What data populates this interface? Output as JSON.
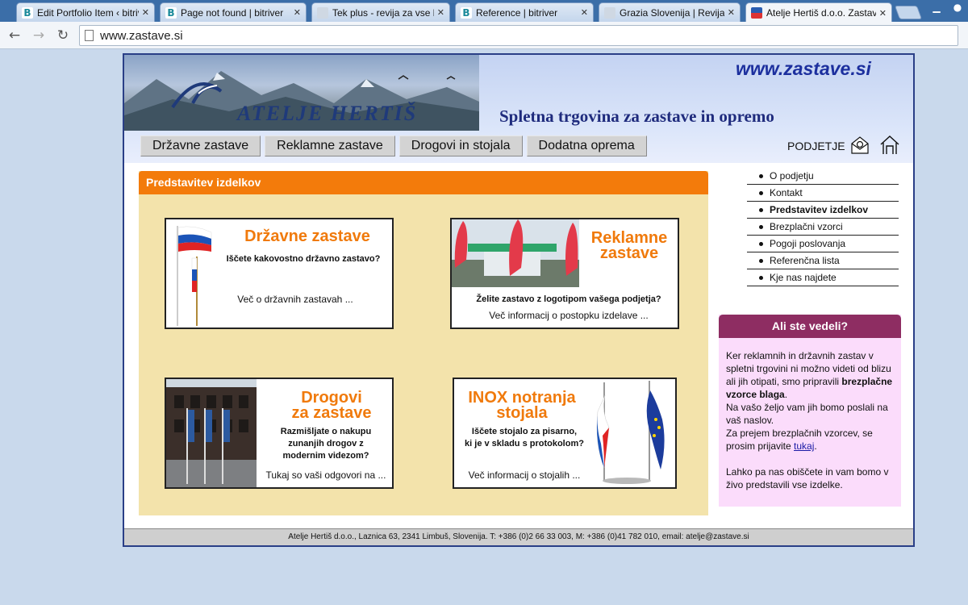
{
  "browser": {
    "tabs": [
      {
        "title": "Edit Portfolio Item ‹ bitriver",
        "favicon": "B"
      },
      {
        "title": "Page not found | bitriver",
        "favicon": "B"
      },
      {
        "title": "Tek plus - revija za vse ljubitelje",
        "favicon": ""
      },
      {
        "title": "Reference | bitriver",
        "favicon": "B"
      },
      {
        "title": "Grazia Slovenija | Revija Grazia",
        "favicon": ""
      },
      {
        "title": "Atelje Hertiš d.o.o. Zastave",
        "favicon": ""
      }
    ],
    "close_glyph": "✕",
    "url": "www.zastave.si",
    "back_glyph": "←",
    "forward_glyph": "→",
    "reload_glyph": "↻"
  },
  "header": {
    "logo_text": "ATELJE HERTIŠ",
    "site_url": "www.zastave.si",
    "tagline": "Spletna trgovina za zastave in opremo",
    "podjetje": "PODJETJE"
  },
  "nav": {
    "items": [
      "Državne zastave",
      "Reklamne zastave",
      "Drogovi in stojala",
      "Dodatna oprema"
    ]
  },
  "panel": {
    "title": "Predstavitev izdelkov",
    "cards": [
      {
        "title": "Državne zastave",
        "subtitle": "Iščete kakovostno državno zastavo?",
        "link": "Več o državnih zastavah ..."
      },
      {
        "title_line1": "Reklamne",
        "title_line2": "zastave",
        "subtitle": "Želite zastavo z logotipom vašega podjetja?",
        "link": "Več informacij o postopku izdelave ..."
      },
      {
        "title_line1": "Drogovi",
        "title_line2": "za zastave",
        "subtitle_line1": "Razmišljate o nakupu",
        "subtitle_line2": "zunanjih drogov z",
        "subtitle_line3": "modernim videzom?",
        "link": "Tukaj so vaši odgovori na ..."
      },
      {
        "title_line1": "INOX notranja",
        "title_line2": "stojala",
        "subtitle_line1": "Iščete stojalo za pisarno,",
        "subtitle_line2": "ki je v skladu s protokolom?",
        "link": "Več informacij o stojalih ..."
      }
    ]
  },
  "sidebar": {
    "items": [
      "O podjetju",
      "Kontakt",
      "Predstavitev izdelkov",
      "Brezplačni vzorci",
      "Pogoji poslovanja",
      "Referenčna lista",
      "Kje nas najdete"
    ],
    "active_index": 2
  },
  "didyou": {
    "title": "Ali ste vedeli?",
    "line1": "Ker reklamnih in državnih zastav v spletni trgovini ni možno videti od blizu ali jih otipati, smo pripravili",
    "bold": "brezplačne vzorce blaga",
    "line1_end": ".",
    "line2": "Na vašo željo vam jih bomo poslali na vaš naslov.",
    "line3": "Za prejem brezplačnih vzorcev, se prosim prijavite",
    "link": "tukaj",
    "line3_end": ".",
    "line4": "Lahko pa nas obiščete in vam bomo v živo predstavili vse izdelke."
  },
  "footer": {
    "text": "Atelje Hertiš d.o.o., Laznica 63, 2341 Limbuš, Slovenija. T: +386 (0)2 66 33 003, M: +386 (0)41 782 010, email: atelje@zastave.si"
  },
  "colors": {
    "panel_orange": "#f37b0b",
    "panel_bg": "#f3e3ab",
    "didyou_head": "#8e2d62",
    "didyou_bg": "#fbdcfb",
    "frame_border": "#2a3f87"
  }
}
